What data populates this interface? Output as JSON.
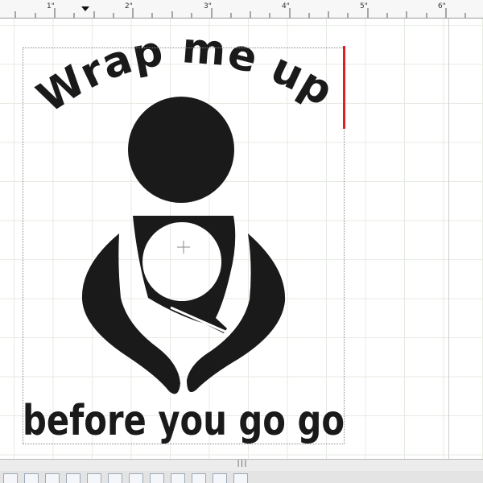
{
  "ruler": {
    "labels": [
      "1\"",
      "2\"",
      "3\"",
      "4\"",
      "5\"",
      "6\""
    ]
  },
  "design": {
    "top_text": "Wrap me up",
    "bottom_text": "before you go go",
    "fill_color": "#1a1a1a"
  },
  "selection": {
    "handle_color": "#e0201c"
  },
  "splitter": {
    "grip": "|||"
  },
  "toolbar": {
    "icons": [
      "new-page-icon",
      "pen-icon",
      "star-icon",
      "image-icon",
      "grid-icon",
      "grid-icon",
      "grid-icon",
      "pattern-icon",
      "dots-pattern-icon",
      "circle-icon",
      "arrows-icon",
      "settings-icon"
    ]
  }
}
